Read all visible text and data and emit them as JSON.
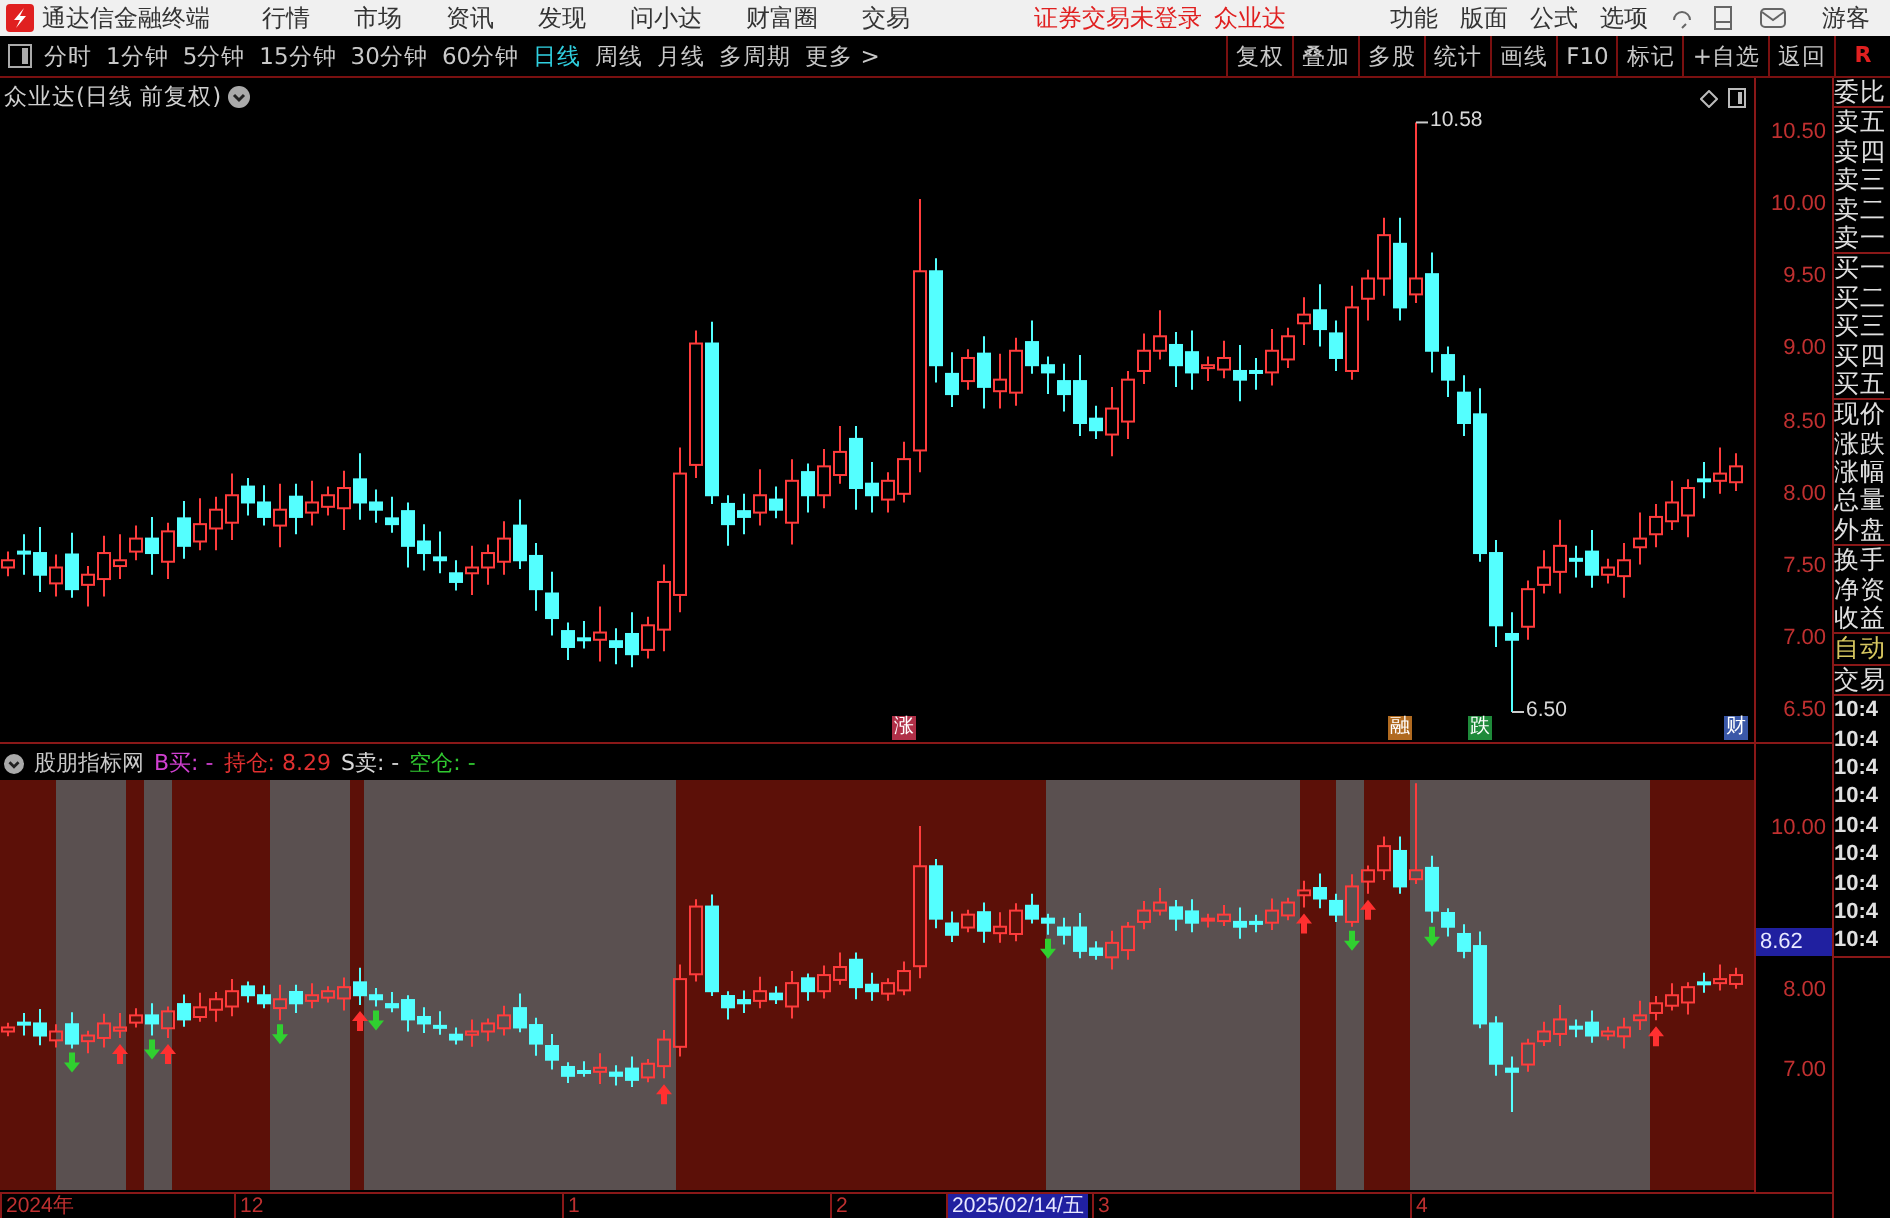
{
  "menu_bar": {
    "app_title": "通达信金融终端",
    "items": [
      "行情",
      "市场",
      "资讯",
      "发现",
      "问小达",
      "财富圈",
      "交易"
    ],
    "notices": [
      "证券交易未登录",
      "众业达"
    ],
    "right_items": [
      "功能",
      "版面",
      "公式",
      "选项"
    ],
    "user": "游客"
  },
  "period_tabs": [
    {
      "label": "分时",
      "selected": false
    },
    {
      "label": "1分钟",
      "selected": false
    },
    {
      "label": "5分钟",
      "selected": false
    },
    {
      "label": "15分钟",
      "selected": false
    },
    {
      "label": "30分钟",
      "selected": false
    },
    {
      "label": "60分钟",
      "selected": false
    },
    {
      "label": "日线",
      "selected": true
    },
    {
      "label": "周线",
      "selected": false
    },
    {
      "label": "月线",
      "selected": false
    },
    {
      "label": "多周期",
      "selected": false
    },
    {
      "label": "更多 >",
      "selected": false
    }
  ],
  "actions": [
    "复权",
    "叠加",
    "多股",
    "统计",
    "画线",
    "F10",
    "标记",
    "+自选",
    "返回"
  ],
  "side_corner": "R",
  "main_chart": {
    "title": "众业达(日线 前复权)",
    "price_ticks": [
      "10.50",
      "10.00",
      "9.50",
      "9.00",
      "8.50",
      "8.00",
      "7.50",
      "7.00",
      "6.50"
    ],
    "high_label": "10.58",
    "low_label": "6.50",
    "events": [
      {
        "label": "涨",
        "color": "#b03048"
      },
      {
        "label": "融",
        "color": "#b06a20"
      },
      {
        "label": "跌",
        "color": "#1e8a3a"
      },
      {
        "label": "财",
        "color": "#3a58a8"
      }
    ]
  },
  "indicator": {
    "name": "股朋指标网",
    "signals": [
      {
        "label": "B买:",
        "value": "-",
        "color": "#d040d0"
      },
      {
        "label": "持仓:",
        "value": "8.29",
        "color": "#e03030"
      },
      {
        "label": "S卖:",
        "value": "-",
        "color": "#d8d8d8"
      },
      {
        "label": "空仓:",
        "value": "-",
        "color": "#30c830"
      }
    ],
    "ticks": [
      "10.00",
      "8.00",
      "7.00"
    ],
    "current_price": "8.62"
  },
  "x_axis": [
    {
      "label": "2024年",
      "selected": false
    },
    {
      "label": "12",
      "selected": false
    },
    {
      "label": "1",
      "selected": false
    },
    {
      "label": "2",
      "selected": false
    },
    {
      "label": "2025/02/14/五",
      "selected": true
    },
    {
      "label": "3",
      "selected": false
    },
    {
      "label": "4",
      "selected": false
    }
  ],
  "side_panel": [
    {
      "items": [
        {
          "label": "委比",
          "kind": "label"
        }
      ]
    },
    {
      "items": [
        {
          "label": "卖五",
          "kind": "label"
        },
        {
          "label": "卖四",
          "kind": "label"
        },
        {
          "label": "卖三",
          "kind": "label"
        },
        {
          "label": "卖二",
          "kind": "label"
        },
        {
          "label": "卖一",
          "kind": "label"
        }
      ]
    },
    {
      "items": [
        {
          "label": "买一",
          "kind": "label"
        },
        {
          "label": "买二",
          "kind": "label"
        },
        {
          "label": "买三",
          "kind": "label"
        },
        {
          "label": "买四",
          "kind": "label"
        },
        {
          "label": "买五",
          "kind": "label"
        }
      ]
    },
    {
      "items": [
        {
          "label": "现价",
          "kind": "label"
        },
        {
          "label": "涨跌",
          "kind": "label"
        },
        {
          "label": "涨幅",
          "kind": "label"
        },
        {
          "label": "总量",
          "kind": "label"
        },
        {
          "label": "外盘",
          "kind": "label"
        }
      ]
    },
    {
      "items": [
        {
          "label": "换手",
          "kind": "label"
        },
        {
          "label": "净资",
          "kind": "label"
        },
        {
          "label": "收益",
          "kind": "label"
        }
      ]
    },
    {
      "items": [
        {
          "label": "自动",
          "kind": "toggle"
        }
      ]
    },
    {
      "items": [
        {
          "label": "交易",
          "kind": "label"
        }
      ]
    },
    {
      "items": [
        {
          "label": "10:4",
          "kind": "time"
        },
        {
          "label": "10:4",
          "kind": "time"
        },
        {
          "label": "10:4",
          "kind": "time"
        },
        {
          "label": "10:4",
          "kind": "time"
        },
        {
          "label": "10:4",
          "kind": "time"
        },
        {
          "label": "10:4",
          "kind": "time"
        },
        {
          "label": "10:4",
          "kind": "time"
        },
        {
          "label": "10:4",
          "kind": "time"
        },
        {
          "label": "10:4",
          "kind": "time"
        }
      ]
    }
  ]
}
